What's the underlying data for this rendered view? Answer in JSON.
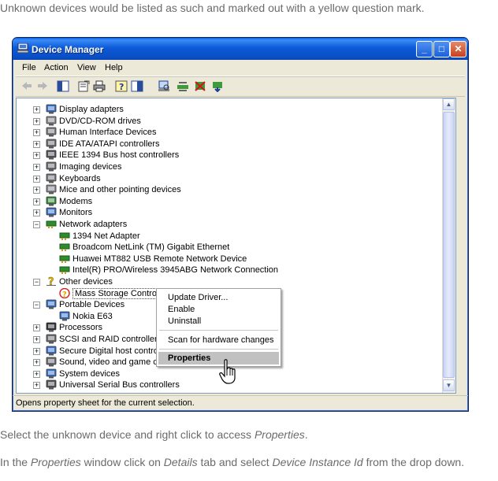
{
  "captions": {
    "top": "Unknown devices would be listed as such and marked out with a yellow question mark.",
    "select_pre": "Select the unknown device and right click to access ",
    "select_em": "Properties",
    "select_post": ".",
    "props_1": "In the ",
    "props_2": "Properties",
    "props_3": " window click on ",
    "props_4": "Details",
    "props_5": " tab and select ",
    "props_6": "Device Instance Id",
    "props_7": " from the drop down."
  },
  "window": {
    "title": "Device Manager",
    "minimize": "_",
    "maximize": "□",
    "close": "✕"
  },
  "menu": [
    "File",
    "Action",
    "View",
    "Help"
  ],
  "tree": [
    {
      "label": "Display adapters",
      "icon": "display-adapter-icon",
      "color": "#3a6fc7"
    },
    {
      "label": "DVD/CD-ROM drives",
      "icon": "cd-drive-icon",
      "color": "#8a8a8a"
    },
    {
      "label": "Human Interface Devices",
      "icon": "hid-icon",
      "color": "#7a7a7a"
    },
    {
      "label": "IDE ATA/ATAPI controllers",
      "icon": "ide-controller-icon",
      "color": "#6d6d6d"
    },
    {
      "label": "IEEE 1394 Bus host controllers",
      "icon": "ieee1394-icon",
      "color": "#555555"
    },
    {
      "label": "Imaging devices",
      "icon": "camera-icon",
      "color": "#6f6f6f"
    },
    {
      "label": "Keyboards",
      "icon": "keyboard-icon",
      "color": "#777777"
    },
    {
      "label": "Mice and other pointing devices",
      "icon": "mouse-icon",
      "color": "#8a8a8a"
    },
    {
      "label": "Modems",
      "icon": "modem-icon",
      "color": "#3a8a3a"
    },
    {
      "label": "Monitors",
      "icon": "monitor-icon",
      "color": "#3a6fc7"
    },
    {
      "label": "Network adapters",
      "icon": "network-adapter-icon",
      "color": "#2e8b2e",
      "expanded": true
    },
    {
      "label": "1394 Net Adapter",
      "icon": "network-card-icon",
      "color": "#2e8b2e",
      "child": true
    },
    {
      "label": "Broadcom NetLink (TM) Gigabit Ethernet",
      "icon": "network-card-icon",
      "color": "#2e8b2e",
      "child": true
    },
    {
      "label": "Huawei MT882 USB Remote Network Device",
      "icon": "network-card-icon",
      "color": "#2e8b2e",
      "child": true
    },
    {
      "label": "Intel(R) PRO/Wireless 3945ABG Network Connection",
      "icon": "network-card-icon",
      "color": "#2e8b2e",
      "child": true
    },
    {
      "label": "Other devices",
      "icon": "unknown-device-icon",
      "color": "#e6b800",
      "expanded": true
    },
    {
      "label": "Mass Storage Controller",
      "icon": "mass-storage-warning-icon",
      "color": "#d9a400",
      "child": true,
      "selected": true
    },
    {
      "label": "Portable Devices",
      "icon": "portable-device-icon",
      "color": "#3a6fc7",
      "expanded": true
    },
    {
      "label": "Nokia E63",
      "icon": "phone-icon",
      "color": "#3a6fc7",
      "child": true
    },
    {
      "label": "Processors",
      "icon": "processor-icon",
      "color": "#333333"
    },
    {
      "label": "SCSI and RAID controllers",
      "icon": "scsi-icon",
      "color": "#6d6d6d"
    },
    {
      "label": "Secure Digital host controlle",
      "icon": "sd-controller-icon",
      "color": "#3a6fc7"
    },
    {
      "label": "Sound, video and game con",
      "icon": "sound-icon",
      "color": "#6d6d6d"
    },
    {
      "label": "System devices",
      "icon": "system-device-icon",
      "color": "#3a6fc7"
    },
    {
      "label": "Universal Serial Bus controllers",
      "icon": "usb-icon",
      "color": "#555555"
    }
  ],
  "context_menu": {
    "update_driver": "Update Driver...",
    "enable": "Enable",
    "uninstall": "Uninstall",
    "scan": "Scan for hardware changes",
    "properties": "Properties"
  },
  "status": "Opens property sheet for the current selection."
}
